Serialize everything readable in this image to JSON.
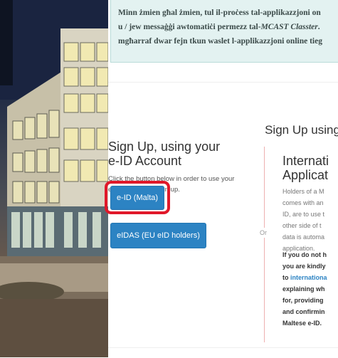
{
  "notice": {
    "line1": "Minn żmien għal żmien, tul il-proċess tal-applikazzjoni on",
    "line2_pre": "u / jew messaġġi awtomatiċi permezz tal-",
    "line2_em": "MCAST Classter",
    "line2_post": ".",
    "line3": "mgħarraf dwar fejn tkun waslet l-applikazzjoni online tieg"
  },
  "signup": {
    "heading": "Sign Up using",
    "eid_title": "Sign Up, using your e-ID Account",
    "eid_desc": "Click the button below in order to use your e-ID Account to sign up.",
    "eid_button": "e-ID (Malta)",
    "eidas_button": "eIDAS (EU eID holders)",
    "or_label": "Or",
    "intl_title_1": "Internati",
    "intl_title_2": "Applicat",
    "intl_desc_lines": [
      "Holders of a M",
      "comes with an",
      "ID, are to use t",
      "other side of t",
      "data is automa",
      "application."
    ],
    "intl_bold_lines": [
      "If you do not h",
      "you are kindly",
      "",
      "explaining wh",
      "for, providing",
      "and confirmin",
      "Maltese e-ID."
    ],
    "intl_link_pre": "to ",
    "intl_link": "internationa"
  },
  "colors": {
    "button_blue": "#2c83c3",
    "highlight_red": "#e0182a",
    "notice_bg": "#e3f2f1"
  }
}
